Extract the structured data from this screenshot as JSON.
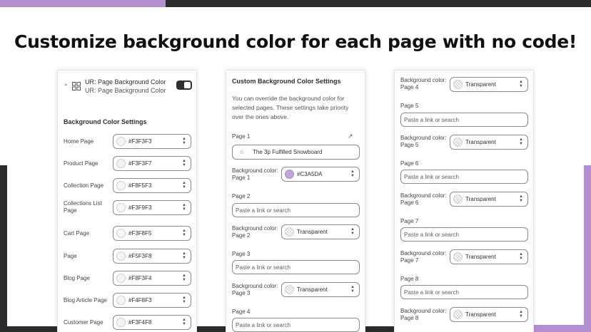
{
  "headline": "Customize background color for each page with no code!",
  "panel1": {
    "app_title": "UR: Page Background Color",
    "app_subtitle": "UR: Page Background Color",
    "section_title": "Background Color Settings",
    "rows": [
      {
        "label": "Home Page",
        "value": "#F3F3F3"
      },
      {
        "label": "Product Page",
        "value": "#F3F3F7"
      },
      {
        "label": "Collection Page",
        "value": "#F8F5F3"
      },
      {
        "label": "Collections List Page",
        "value": "#F3F9F3"
      },
      {
        "label": "Cart Page",
        "value": "#F3F8F5"
      },
      {
        "label": "Page",
        "value": "#F5F3F8"
      },
      {
        "label": "Blog Page",
        "value": "#F8F3F4"
      },
      {
        "label": "Blog Article Page",
        "value": "#F4F8F3"
      },
      {
        "label": "Customer Page",
        "value": "#F3F4F8"
      }
    ]
  },
  "panel2": {
    "title": "Custom Background Color Settings",
    "description": "You can override the background color for selected pages. These settings take priority over the ones above.",
    "page1_label": "Page 1",
    "page1_product": "The 3p Fulfilled Snowboard",
    "page1_bg_label": "Background color: Page 1",
    "page1_bg_value": "#C3A5DA",
    "page2_label": "Page 2",
    "page2_placeholder": "Paste a link or search",
    "page2_bg_label": "Background color: Page 2",
    "page2_bg_value": "Transparent",
    "page3_label": "Page 3",
    "page3_placeholder": "Paste a link or search",
    "page3_bg_label": "Background color: Page 3",
    "page3_bg_value": "Transparent",
    "page4_label": "Page 4",
    "page4_placeholder": "Paste a link or search"
  },
  "panel3": {
    "page4_bg_label": "Background color: Page 4",
    "page4_bg_value": "Transparent",
    "page5_label": "Page 5",
    "page5_placeholder": "Paste a link or search",
    "page5_bg_label": "Background color: Page 5",
    "page5_bg_value": "Transparent",
    "page6_label": "Page 6",
    "page6_placeholder": "Paste a link or search",
    "page6_bg_label": "Background color: Page 6",
    "page6_bg_value": "Transparent",
    "page7_label": "Page 7",
    "page7_placeholder": "Paste a link or search",
    "page7_bg_label": "Background color: Page 7",
    "page7_bg_value": "Transparent",
    "page8_label": "Page 8",
    "page8_placeholder": "Paste a link or search",
    "page8_bg_label": "Background color: Page 8",
    "page8_bg_value": "Transparent"
  },
  "colors": {
    "accent_purple": "#b48fd0",
    "dark_bar": "#2b2b2b",
    "selected_swatch": "#C3A5DA"
  }
}
